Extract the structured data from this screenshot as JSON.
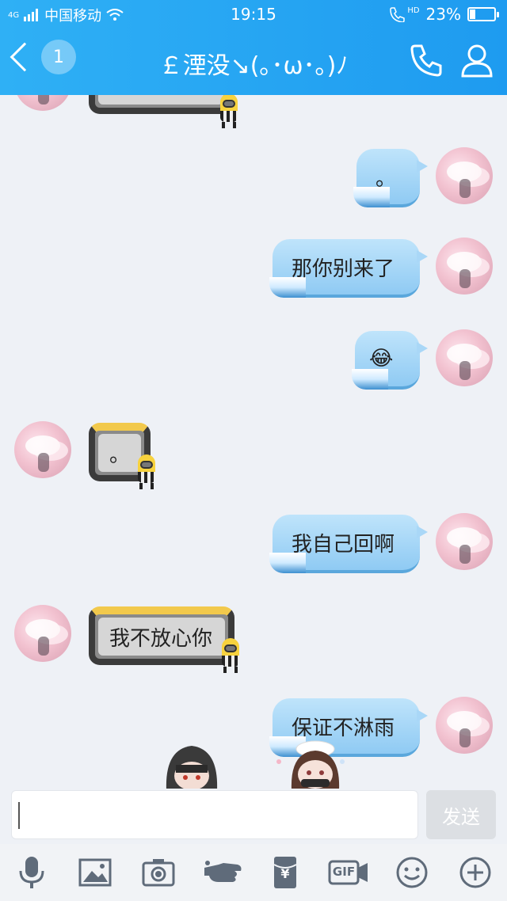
{
  "status_bar": {
    "network": "4G",
    "carrier": "中国移动",
    "time": "19:15",
    "hd": "HD",
    "battery_percent": "23%",
    "battery_level": 0.23
  },
  "nav": {
    "unread_count": "1",
    "title": "￡湮没↘(｡･ω･｡)ﾉ"
  },
  "messages": [
    {
      "side": "left",
      "text": ""
    },
    {
      "side": "right",
      "text": "。"
    },
    {
      "side": "right",
      "text": "那你别来了"
    },
    {
      "side": "right",
      "text": "😂"
    },
    {
      "side": "left",
      "text": "。"
    },
    {
      "side": "right",
      "text": "我自己回啊"
    },
    {
      "side": "left",
      "text": "我不放心你"
    },
    {
      "side": "right",
      "text": "保证不淋雨"
    }
  ],
  "input": {
    "value": "",
    "send_label": "发送"
  },
  "toolbar": {
    "items": [
      "mic-icon",
      "image-icon",
      "camera-icon",
      "poke-icon",
      "red-packet-icon",
      "gif-icon",
      "emoji-icon",
      "plus-icon"
    ],
    "gif_label": "GIF",
    "redpacket_label": "¥"
  },
  "colors": {
    "header": "#1e9bf0",
    "bubble_right": "#a9d7f7",
    "bubble_left_frame": "#f2c94c",
    "background": "#eef1f6"
  }
}
